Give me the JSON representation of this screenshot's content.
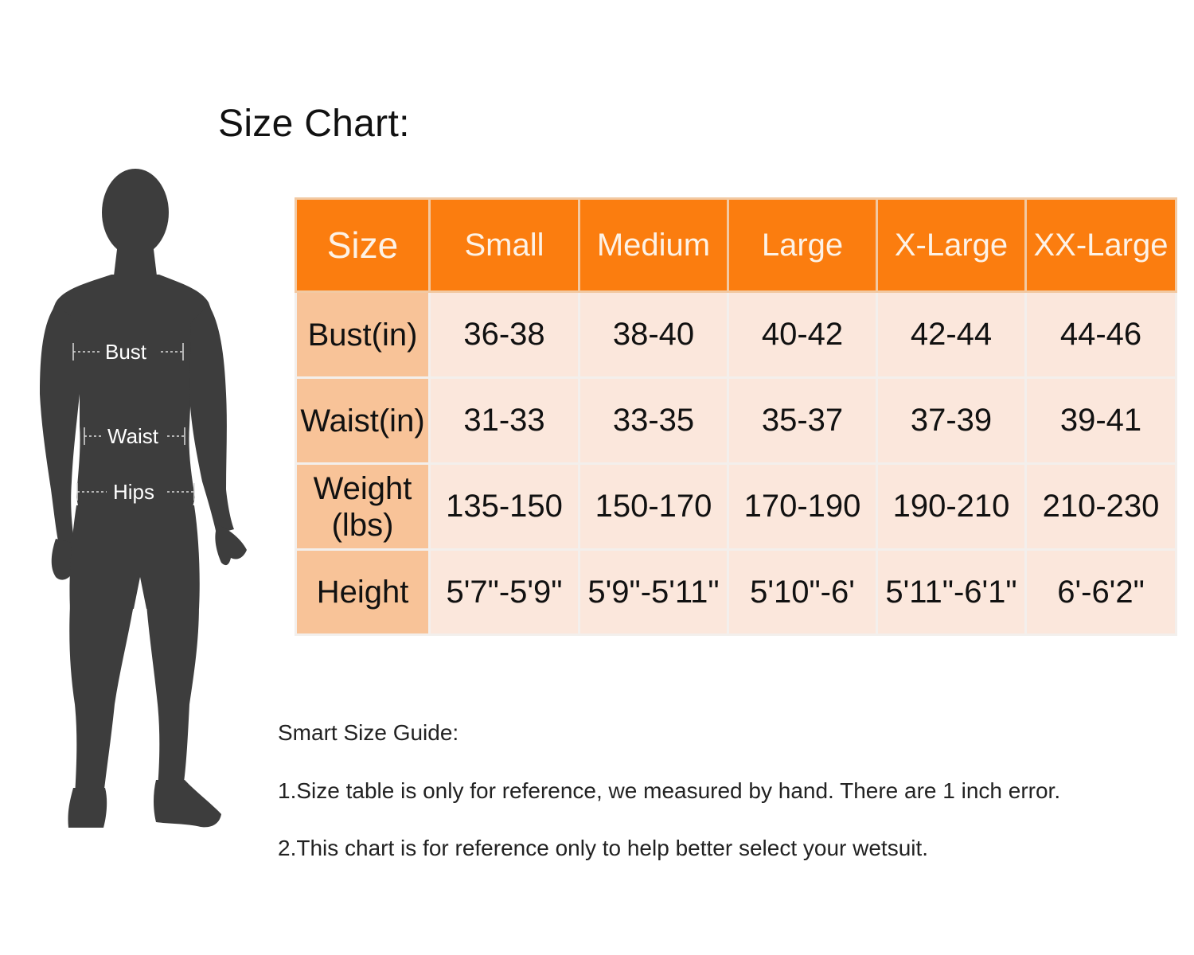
{
  "title": "Size Chart:",
  "figure": {
    "labels": {
      "bust": "Bust",
      "waist": "Waist",
      "hips": "Hips"
    },
    "silhouette_color": "#3d3d3d"
  },
  "table": {
    "header_color": "#fb7d0f",
    "rowhead_color": "#f8c398",
    "cell_color": "#fbe7dc",
    "corner": "Size",
    "sizes": [
      "Small",
      "Medium",
      "Large",
      "X-Large",
      "XX-Large"
    ],
    "rows": [
      {
        "label": "Bust(in)",
        "values": [
          "36-38",
          "38-40",
          "40-42",
          "42-44",
          "44-46"
        ]
      },
      {
        "label": "Waist(in)",
        "values": [
          "31-33",
          "33-35",
          "35-37",
          "37-39",
          "39-41"
        ]
      },
      {
        "label_line1": "Weight",
        "label_line2": "(lbs)",
        "values": [
          "135-150",
          "150-170",
          "170-190",
          "190-210",
          "210-230"
        ]
      },
      {
        "label": "Height",
        "values": [
          "5'7\"-5'9\"",
          "5'9\"-5'11\"",
          "5'10\"-6'",
          "5'11\"-6'1\"",
          "6'-6'2\""
        ]
      }
    ]
  },
  "guide": {
    "title": "Smart Size Guide:",
    "lines": [
      "1.Size table is only for reference, we measured by hand. There are 1 inch error.",
      "2.This chart is for reference only to help better select your wetsuit."
    ]
  }
}
